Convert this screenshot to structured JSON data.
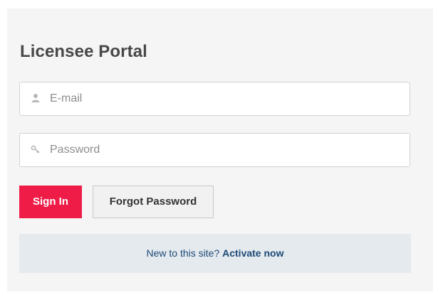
{
  "portal": {
    "title": "Licensee Portal"
  },
  "email": {
    "placeholder": "E-mail",
    "value": "",
    "icon": "user-icon"
  },
  "password": {
    "placeholder": "Password",
    "value": "",
    "icon": "key-icon"
  },
  "actions": {
    "signin_label": "Sign In",
    "forgot_label": "Forgot Password"
  },
  "notice": {
    "text": "New to this site?",
    "link_label": "Activate now"
  },
  "colors": {
    "primary": "#ee1c47",
    "link": "#1c4a77",
    "panel_bg": "#f5f5f5",
    "notice_bg": "#e5eaee"
  }
}
